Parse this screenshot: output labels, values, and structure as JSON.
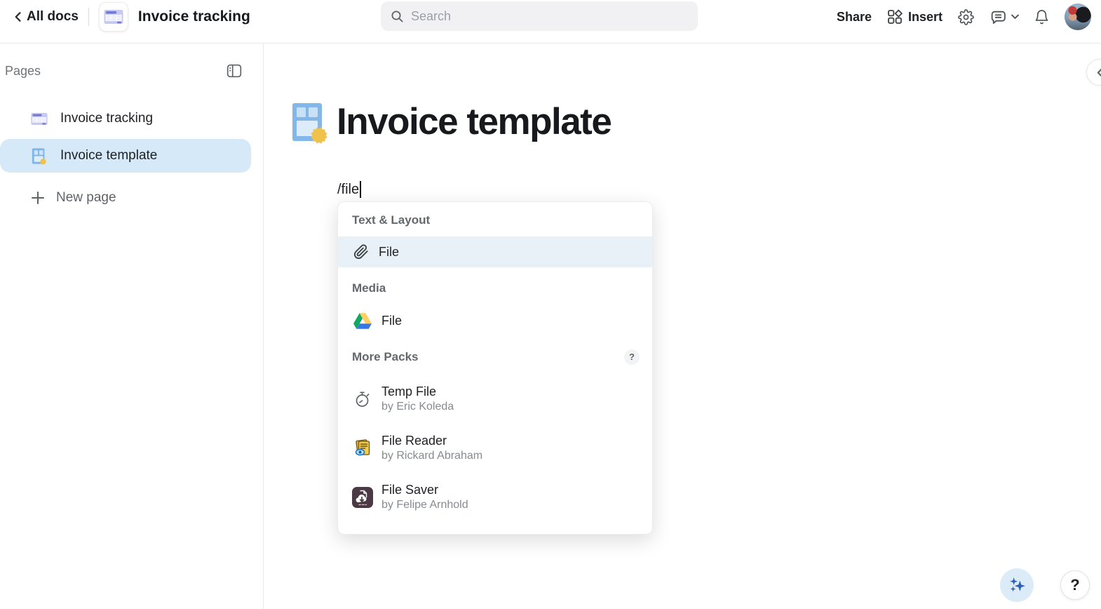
{
  "header": {
    "back_label": "All docs",
    "doc_title": "Invoice tracking",
    "search_placeholder": "Search",
    "share_label": "Share",
    "insert_label": "Insert"
  },
  "sidebar": {
    "title": "Pages",
    "items": [
      {
        "label": "Invoice tracking",
        "icon": "doc-table-icon",
        "selected": false
      },
      {
        "label": "Invoice template",
        "icon": "template-page-icon",
        "selected": true
      }
    ],
    "new_page_label": "New page"
  },
  "page": {
    "title": "Invoice template",
    "slash_input": "/file"
  },
  "slash_menu": {
    "sections": [
      {
        "header": "Text & Layout",
        "items": [
          {
            "label": "File",
            "icon": "paperclip-icon",
            "highlighted": true
          }
        ]
      },
      {
        "header": "Media",
        "items": [
          {
            "label": "File",
            "icon": "google-drive-icon"
          }
        ]
      },
      {
        "header": "More Packs",
        "help_badge": "?",
        "items": [
          {
            "label": "Temp File",
            "byline": "by Eric Koleda",
            "icon": "stopwatch-icon"
          },
          {
            "label": "File Reader",
            "byline": "by Rickard Abraham",
            "icon": "file-reader-icon"
          },
          {
            "label": "File Saver",
            "byline": "by Felipe Arnhold",
            "icon": "file-saver-icon"
          }
        ]
      }
    ]
  },
  "floating": {
    "help_label": "?"
  },
  "colors": {
    "sidebar_selection": "#d6e9f8",
    "menu_highlight": "#e9f1f8",
    "badge_yellow": "#f0c14b",
    "sparkle_blue": "#2d5fb4",
    "drive_green": "#11A861",
    "drive_yellow": "#FFCF63",
    "drive_blue": "#3777E3"
  }
}
